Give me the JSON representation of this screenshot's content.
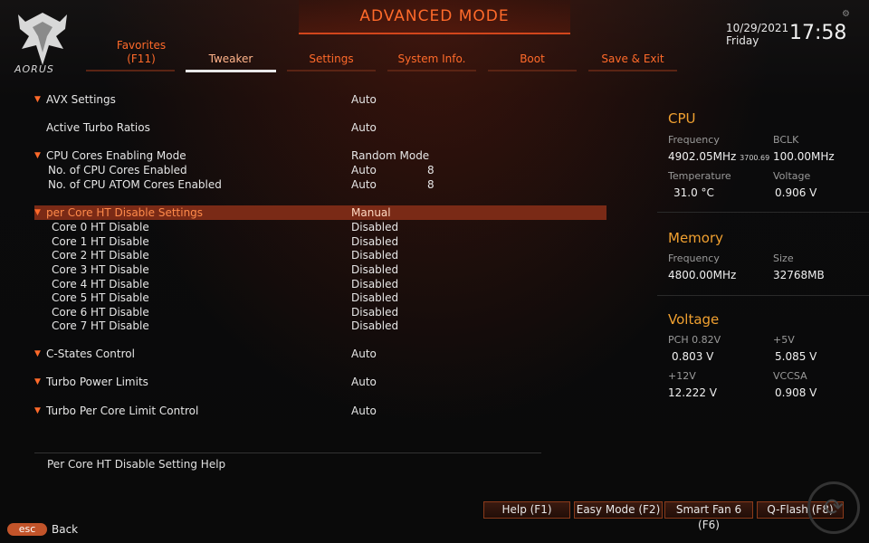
{
  "header": {
    "title": "ADVANCED MODE",
    "logo_text": "AORUS",
    "date": "10/29/2021",
    "day": "Friday",
    "time": "17:58"
  },
  "tabs": [
    {
      "label": "Favorites",
      "label2": "(F11)"
    },
    {
      "label": "Tweaker"
    },
    {
      "label": "Settings"
    },
    {
      "label": "System Info."
    },
    {
      "label": "Boot"
    },
    {
      "label": "Save & Exit"
    }
  ],
  "menu": [
    {
      "label": "AVX Settings",
      "value": "Auto"
    },
    {
      "label": "Active Turbo Ratios",
      "value": "Auto"
    },
    {
      "label": "CPU Cores Enabling Mode",
      "value": "Random Mode"
    },
    {
      "label": "No. of CPU Cores Enabled",
      "value": "Auto",
      "num": "8"
    },
    {
      "label": "No. of CPU ATOM Cores Enabled",
      "value": "Auto",
      "num": "8"
    },
    {
      "label": "per Core HT Disable Settings",
      "value": "Manual"
    },
    {
      "label": "Core 0 HT Disable",
      "value": "Disabled"
    },
    {
      "label": "Core 1 HT Disable",
      "value": "Disabled"
    },
    {
      "label": "Core 2 HT Disable",
      "value": "Disabled"
    },
    {
      "label": "Core 3 HT Disable",
      "value": "Disabled"
    },
    {
      "label": "Core 4 HT Disable",
      "value": "Disabled"
    },
    {
      "label": "Core 5 HT Disable",
      "value": "Disabled"
    },
    {
      "label": "Core 6 HT Disable",
      "value": "Disabled"
    },
    {
      "label": "Core 7 HT Disable",
      "value": "Disabled"
    },
    {
      "label": "C-States Control",
      "value": "Auto"
    },
    {
      "label": "Turbo Power Limits",
      "value": "Auto"
    },
    {
      "label": "Turbo Per Core Limit Control",
      "value": "Auto"
    }
  ],
  "help_text": "Per Core HT Disable Setting Help",
  "cpu": {
    "title": "CPU",
    "freq_label": "Frequency",
    "freq": "4902.05MHz",
    "freq_small": "3700.69",
    "bclk_label": "BCLK",
    "bclk": "100.00MHz",
    "temp_label": "Temperature",
    "temp": "31.0 °C",
    "volt_label": "Voltage",
    "volt": "0.906 V"
  },
  "memory": {
    "title": "Memory",
    "freq_label": "Frequency",
    "freq": "4800.00MHz",
    "size_label": "Size",
    "size": "32768MB"
  },
  "voltage": {
    "title": "Voltage",
    "pch_label": "PCH 0.82V",
    "pch": "0.803 V",
    "v5_label": "+5V",
    "v5": "5.085 V",
    "v12_label": "+12V",
    "v12": "12.222 V",
    "vccsa_label": "VCCSA",
    "vccsa": "0.908 V"
  },
  "buttons": {
    "help": "Help (F1)",
    "easy": "Easy Mode (F2)",
    "fan": "Smart Fan 6 (F6)",
    "qflash": "Q-Flash (F8)",
    "esc": "esc",
    "back": "Back"
  },
  "colors": {
    "accent": "#ff6a2a",
    "highlight": "#7a2a16",
    "panel_title": "#f0a030"
  }
}
